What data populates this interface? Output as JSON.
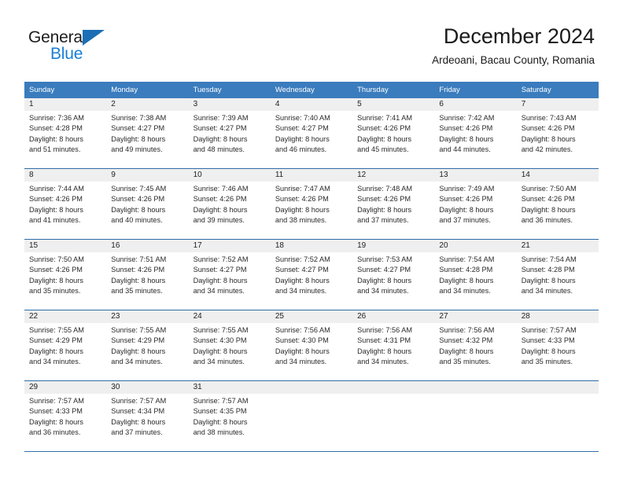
{
  "brand": {
    "name_part1": "General",
    "name_part2": "Blue",
    "triangle_icon": "triangle-icon",
    "colors": {
      "blue": "#1a7fd4",
      "triangle": "#1c6fb5",
      "dark": "#1d1d1d"
    }
  },
  "header": {
    "title": "December 2024",
    "subtitle": "Ardeoani, Bacau County, Romania"
  },
  "calendar": {
    "header_bg": "#3a7cbd",
    "daynum_bg": "#efefef",
    "rule_color": "#2e6da8",
    "weekdays": [
      "Sunday",
      "Monday",
      "Tuesday",
      "Wednesday",
      "Thursday",
      "Friday",
      "Saturday"
    ],
    "weeks": [
      [
        {
          "day": "1",
          "sunrise": "Sunrise: 7:36 AM",
          "sunset": "Sunset: 4:28 PM",
          "daylight1": "Daylight: 8 hours",
          "daylight2": "and 51 minutes."
        },
        {
          "day": "2",
          "sunrise": "Sunrise: 7:38 AM",
          "sunset": "Sunset: 4:27 PM",
          "daylight1": "Daylight: 8 hours",
          "daylight2": "and 49 minutes."
        },
        {
          "day": "3",
          "sunrise": "Sunrise: 7:39 AM",
          "sunset": "Sunset: 4:27 PM",
          "daylight1": "Daylight: 8 hours",
          "daylight2": "and 48 minutes."
        },
        {
          "day": "4",
          "sunrise": "Sunrise: 7:40 AM",
          "sunset": "Sunset: 4:27 PM",
          "daylight1": "Daylight: 8 hours",
          "daylight2": "and 46 minutes."
        },
        {
          "day": "5",
          "sunrise": "Sunrise: 7:41 AM",
          "sunset": "Sunset: 4:26 PM",
          "daylight1": "Daylight: 8 hours",
          "daylight2": "and 45 minutes."
        },
        {
          "day": "6",
          "sunrise": "Sunrise: 7:42 AM",
          "sunset": "Sunset: 4:26 PM",
          "daylight1": "Daylight: 8 hours",
          "daylight2": "and 44 minutes."
        },
        {
          "day": "7",
          "sunrise": "Sunrise: 7:43 AM",
          "sunset": "Sunset: 4:26 PM",
          "daylight1": "Daylight: 8 hours",
          "daylight2": "and 42 minutes."
        }
      ],
      [
        {
          "day": "8",
          "sunrise": "Sunrise: 7:44 AM",
          "sunset": "Sunset: 4:26 PM",
          "daylight1": "Daylight: 8 hours",
          "daylight2": "and 41 minutes."
        },
        {
          "day": "9",
          "sunrise": "Sunrise: 7:45 AM",
          "sunset": "Sunset: 4:26 PM",
          "daylight1": "Daylight: 8 hours",
          "daylight2": "and 40 minutes."
        },
        {
          "day": "10",
          "sunrise": "Sunrise: 7:46 AM",
          "sunset": "Sunset: 4:26 PM",
          "daylight1": "Daylight: 8 hours",
          "daylight2": "and 39 minutes."
        },
        {
          "day": "11",
          "sunrise": "Sunrise: 7:47 AM",
          "sunset": "Sunset: 4:26 PM",
          "daylight1": "Daylight: 8 hours",
          "daylight2": "and 38 minutes."
        },
        {
          "day": "12",
          "sunrise": "Sunrise: 7:48 AM",
          "sunset": "Sunset: 4:26 PM",
          "daylight1": "Daylight: 8 hours",
          "daylight2": "and 37 minutes."
        },
        {
          "day": "13",
          "sunrise": "Sunrise: 7:49 AM",
          "sunset": "Sunset: 4:26 PM",
          "daylight1": "Daylight: 8 hours",
          "daylight2": "and 37 minutes."
        },
        {
          "day": "14",
          "sunrise": "Sunrise: 7:50 AM",
          "sunset": "Sunset: 4:26 PM",
          "daylight1": "Daylight: 8 hours",
          "daylight2": "and 36 minutes."
        }
      ],
      [
        {
          "day": "15",
          "sunrise": "Sunrise: 7:50 AM",
          "sunset": "Sunset: 4:26 PM",
          "daylight1": "Daylight: 8 hours",
          "daylight2": "and 35 minutes."
        },
        {
          "day": "16",
          "sunrise": "Sunrise: 7:51 AM",
          "sunset": "Sunset: 4:26 PM",
          "daylight1": "Daylight: 8 hours",
          "daylight2": "and 35 minutes."
        },
        {
          "day": "17",
          "sunrise": "Sunrise: 7:52 AM",
          "sunset": "Sunset: 4:27 PM",
          "daylight1": "Daylight: 8 hours",
          "daylight2": "and 34 minutes."
        },
        {
          "day": "18",
          "sunrise": "Sunrise: 7:52 AM",
          "sunset": "Sunset: 4:27 PM",
          "daylight1": "Daylight: 8 hours",
          "daylight2": "and 34 minutes."
        },
        {
          "day": "19",
          "sunrise": "Sunrise: 7:53 AM",
          "sunset": "Sunset: 4:27 PM",
          "daylight1": "Daylight: 8 hours",
          "daylight2": "and 34 minutes."
        },
        {
          "day": "20",
          "sunrise": "Sunrise: 7:54 AM",
          "sunset": "Sunset: 4:28 PM",
          "daylight1": "Daylight: 8 hours",
          "daylight2": "and 34 minutes."
        },
        {
          "day": "21",
          "sunrise": "Sunrise: 7:54 AM",
          "sunset": "Sunset: 4:28 PM",
          "daylight1": "Daylight: 8 hours",
          "daylight2": "and 34 minutes."
        }
      ],
      [
        {
          "day": "22",
          "sunrise": "Sunrise: 7:55 AM",
          "sunset": "Sunset: 4:29 PM",
          "daylight1": "Daylight: 8 hours",
          "daylight2": "and 34 minutes."
        },
        {
          "day": "23",
          "sunrise": "Sunrise: 7:55 AM",
          "sunset": "Sunset: 4:29 PM",
          "daylight1": "Daylight: 8 hours",
          "daylight2": "and 34 minutes."
        },
        {
          "day": "24",
          "sunrise": "Sunrise: 7:55 AM",
          "sunset": "Sunset: 4:30 PM",
          "daylight1": "Daylight: 8 hours",
          "daylight2": "and 34 minutes."
        },
        {
          "day": "25",
          "sunrise": "Sunrise: 7:56 AM",
          "sunset": "Sunset: 4:30 PM",
          "daylight1": "Daylight: 8 hours",
          "daylight2": "and 34 minutes."
        },
        {
          "day": "26",
          "sunrise": "Sunrise: 7:56 AM",
          "sunset": "Sunset: 4:31 PM",
          "daylight1": "Daylight: 8 hours",
          "daylight2": "and 34 minutes."
        },
        {
          "day": "27",
          "sunrise": "Sunrise: 7:56 AM",
          "sunset": "Sunset: 4:32 PM",
          "daylight1": "Daylight: 8 hours",
          "daylight2": "and 35 minutes."
        },
        {
          "day": "28",
          "sunrise": "Sunrise: 7:57 AM",
          "sunset": "Sunset: 4:33 PM",
          "daylight1": "Daylight: 8 hours",
          "daylight2": "and 35 minutes."
        }
      ],
      [
        {
          "day": "29",
          "sunrise": "Sunrise: 7:57 AM",
          "sunset": "Sunset: 4:33 PM",
          "daylight1": "Daylight: 8 hours",
          "daylight2": "and 36 minutes."
        },
        {
          "day": "30",
          "sunrise": "Sunrise: 7:57 AM",
          "sunset": "Sunset: 4:34 PM",
          "daylight1": "Daylight: 8 hours",
          "daylight2": "and 37 minutes."
        },
        {
          "day": "31",
          "sunrise": "Sunrise: 7:57 AM",
          "sunset": "Sunset: 4:35 PM",
          "daylight1": "Daylight: 8 hours",
          "daylight2": "and 38 minutes."
        },
        {
          "day": "",
          "sunrise": "",
          "sunset": "",
          "daylight1": "",
          "daylight2": ""
        },
        {
          "day": "",
          "sunrise": "",
          "sunset": "",
          "daylight1": "",
          "daylight2": ""
        },
        {
          "day": "",
          "sunrise": "",
          "sunset": "",
          "daylight1": "",
          "daylight2": ""
        },
        {
          "day": "",
          "sunrise": "",
          "sunset": "",
          "daylight1": "",
          "daylight2": ""
        }
      ]
    ]
  }
}
